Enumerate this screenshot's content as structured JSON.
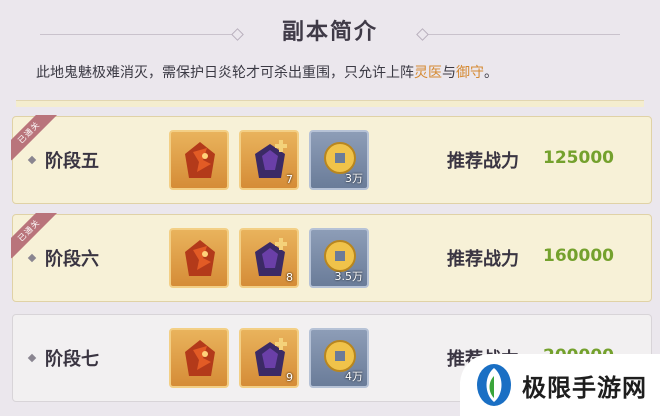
{
  "title": "副本简介",
  "description": {
    "text_before": "此地鬼魅极难消灭，需保护日炎轮才可杀出重围，只允许上阵",
    "highlight_1": "灵医",
    "text_mid": "与",
    "highlight_2": "御守",
    "text_after": "。"
  },
  "stages": [
    {
      "name": "阶段五",
      "badge": "已通关",
      "rewards": [
        {
          "icon": "red-phoenix-icon",
          "quantity": ""
        },
        {
          "icon": "purple-mask-icon",
          "quantity": "7"
        },
        {
          "icon": "gold-coin-icon",
          "quantity": "3万"
        }
      ],
      "power_label": "推荐战力",
      "power_value": "125000"
    },
    {
      "name": "阶段六",
      "badge": "已通关",
      "rewards": [
        {
          "icon": "red-phoenix-icon",
          "quantity": ""
        },
        {
          "icon": "purple-mask-icon",
          "quantity": "8"
        },
        {
          "icon": "gold-coin-icon",
          "quantity": "3.5万"
        }
      ],
      "power_label": "推荐战力",
      "power_value": "160000"
    },
    {
      "name": "阶段七",
      "badge": "",
      "rewards": [
        {
          "icon": "red-phoenix-icon",
          "quantity": ""
        },
        {
          "icon": "purple-mask-icon",
          "quantity": "9"
        },
        {
          "icon": "gold-coin-icon",
          "quantity": "4万"
        }
      ],
      "power_label": "推荐战力",
      "power_value": "200000"
    }
  ],
  "watermark": {
    "text": "极限手游网"
  },
  "colors": {
    "accent_green": "#74a12d",
    "highlight_orange": "#d58a32",
    "cleared_badge": "#b9747b"
  }
}
